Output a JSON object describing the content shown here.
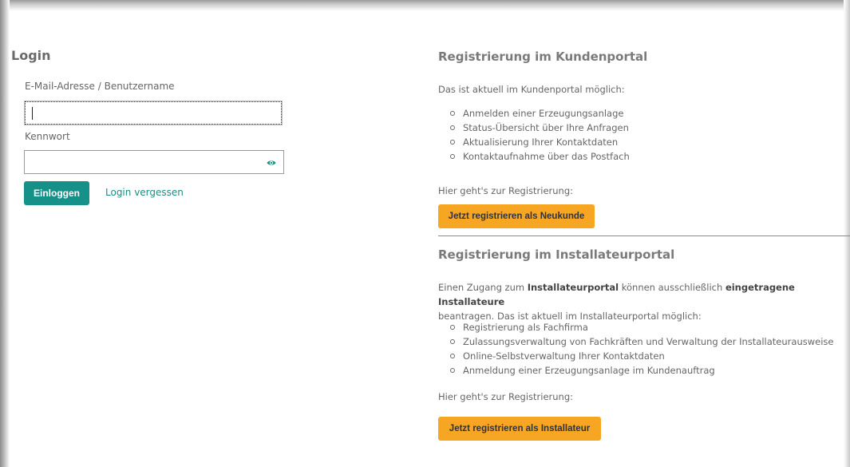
{
  "login": {
    "title": "Login",
    "username_label": "E-Mail-Adresse / Benutzername",
    "username_value": "",
    "password_label": "Kennwort",
    "password_value": "",
    "submit_label": "Einloggen",
    "forgot_label": "Login vergessen"
  },
  "kundenportal": {
    "title": "Registrierung im Kundenportal",
    "intro": "Das ist aktuell im Kundenportal möglich:",
    "items": [
      "Anmelden einer Erzeugungsanlage",
      "Status-Übersicht über Ihre Anfragen",
      "Aktualisierung Ihrer Kontaktdaten",
      "Kontaktaufnahme über das Postfach"
    ],
    "cta_text": "Hier geht's zur Registrierung:",
    "button_label": "Jetzt registrieren als Neukunde"
  },
  "installateurportal": {
    "title": "Registrierung im Installateurportal",
    "intro_part1": "Einen Zugang zum ",
    "intro_bold1": "Installateurportal",
    "intro_part2": " können ausschließlich ",
    "intro_bold2": "eingetragene Installateure",
    "intro_part3": "beantragen. Das ist aktuell im Installateurportal möglich:",
    "items": [
      "Registrierung als Fachfirma",
      "Zulassungsverwaltung von Fachkräften und Verwaltung der Installateurausweise",
      "Online-Selbstverwaltung Ihrer Kontaktdaten",
      "Anmeldung einer Erzeugungsanlage im Kundenauftrag"
    ],
    "cta_text": "Hier geht's zur Registrierung:",
    "button_label": "Jetzt registrieren als Installateur"
  },
  "colors": {
    "primary_teal": "#16918a",
    "accent_orange": "#f6a623",
    "link_teal": "#1f8a85"
  },
  "icons": {
    "password_toggle": "eye-icon"
  }
}
